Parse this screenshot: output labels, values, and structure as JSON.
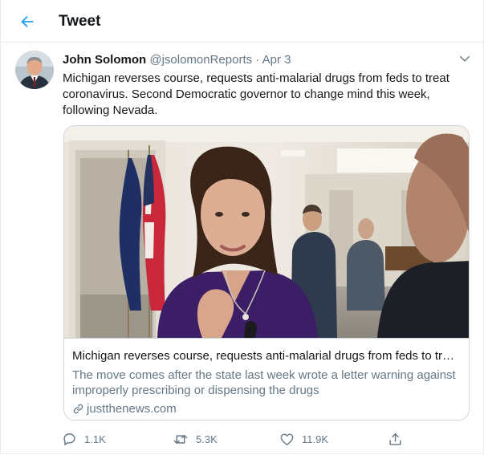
{
  "header": {
    "title": "Tweet",
    "back_icon": "arrow-left-icon",
    "accent_color": "#1da1f2"
  },
  "tweet": {
    "author_name": "John Solomon",
    "handle": "@jsolomonReports",
    "separator": "·",
    "date": "Apr 3",
    "text": "Michigan reverses course, requests anti-malarial drugs from feds to treat coronavirus. Second Democratic governor to change mind this week, following Nevada.",
    "menu_icon": "chevron-down-icon"
  },
  "card": {
    "title": "Michigan reverses course, requests anti-malarial drugs from feds to trea...",
    "description": "The move comes after the state last week wrote a letter warning against improperly prescribing or dispensing the drugs",
    "domain": "justthenews.com",
    "link_icon": "link-icon"
  },
  "actions": {
    "replies": "1.1K",
    "retweets": "5.3K",
    "likes": "11.9K",
    "reply_icon": "reply-icon",
    "retweet_icon": "retweet-icon",
    "like_icon": "heart-icon",
    "share_icon": "share-icon"
  },
  "colors": {
    "text_primary": "#14171a",
    "text_secondary": "#657786",
    "border": "#e6ecf0"
  }
}
